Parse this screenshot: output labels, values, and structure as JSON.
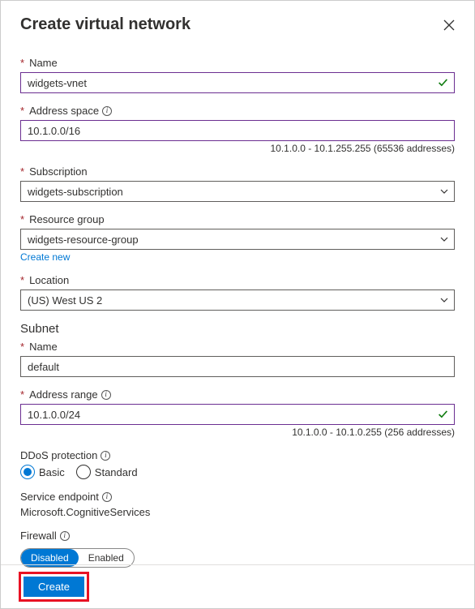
{
  "header": {
    "title": "Create virtual network"
  },
  "fields": {
    "name": {
      "label": "Name",
      "value": "widgets-vnet"
    },
    "addressSpace": {
      "label": "Address space",
      "value": "10.1.0.0/16",
      "hint": "10.1.0.0 - 10.1.255.255 (65536 addresses)"
    },
    "subscription": {
      "label": "Subscription",
      "value": "widgets-subscription"
    },
    "resourceGroup": {
      "label": "Resource group",
      "value": "widgets-resource-group",
      "createNew": "Create new"
    },
    "location": {
      "label": "Location",
      "value": "(US) West US 2"
    }
  },
  "subnet": {
    "heading": "Subnet",
    "name": {
      "label": "Name",
      "value": "default"
    },
    "addressRange": {
      "label": "Address range",
      "value": "10.1.0.0/24",
      "hint": "10.1.0.0 - 10.1.0.255 (256 addresses)"
    }
  },
  "ddos": {
    "label": "DDoS protection",
    "options": {
      "basic": "Basic",
      "standard": "Standard"
    },
    "selected": "basic"
  },
  "serviceEndpoint": {
    "label": "Service endpoint",
    "value": "Microsoft.CognitiveServices"
  },
  "firewall": {
    "label": "Firewall",
    "options": {
      "disabled": "Disabled",
      "enabled": "Enabled"
    },
    "selected": "disabled"
  },
  "footer": {
    "create": "Create"
  }
}
